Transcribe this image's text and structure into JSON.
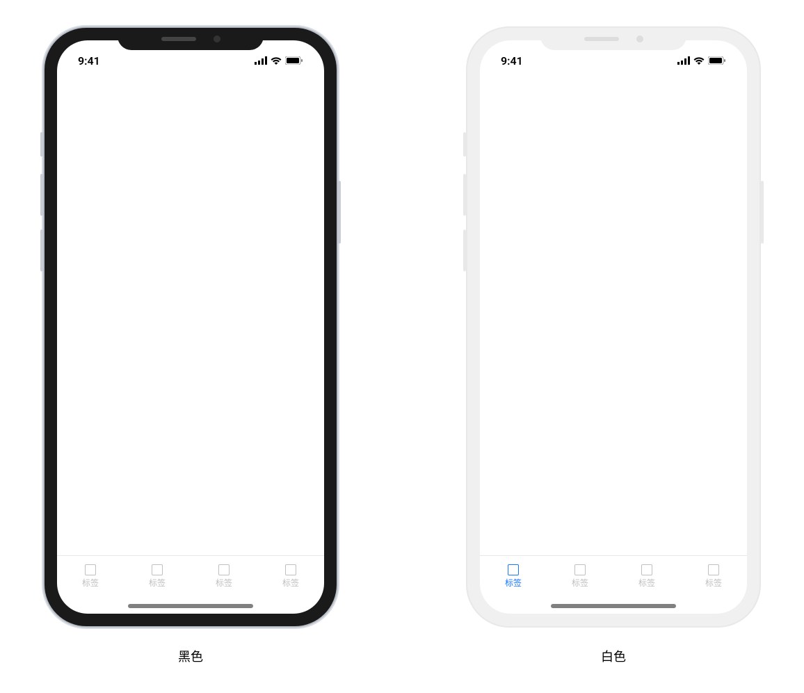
{
  "phones": [
    {
      "variant": "dark",
      "status_time": "9:41",
      "tabs": [
        {
          "label": "标签",
          "active": false
        },
        {
          "label": "标签",
          "active": false
        },
        {
          "label": "标签",
          "active": false
        },
        {
          "label": "标签",
          "active": false
        }
      ],
      "caption": "黑色"
    },
    {
      "variant": "light",
      "status_time": "9:41",
      "tabs": [
        {
          "label": "标签",
          "active": true
        },
        {
          "label": "标签",
          "active": false
        },
        {
          "label": "标签",
          "active": false
        },
        {
          "label": "标签",
          "active": false
        }
      ],
      "caption": "白色"
    }
  ]
}
